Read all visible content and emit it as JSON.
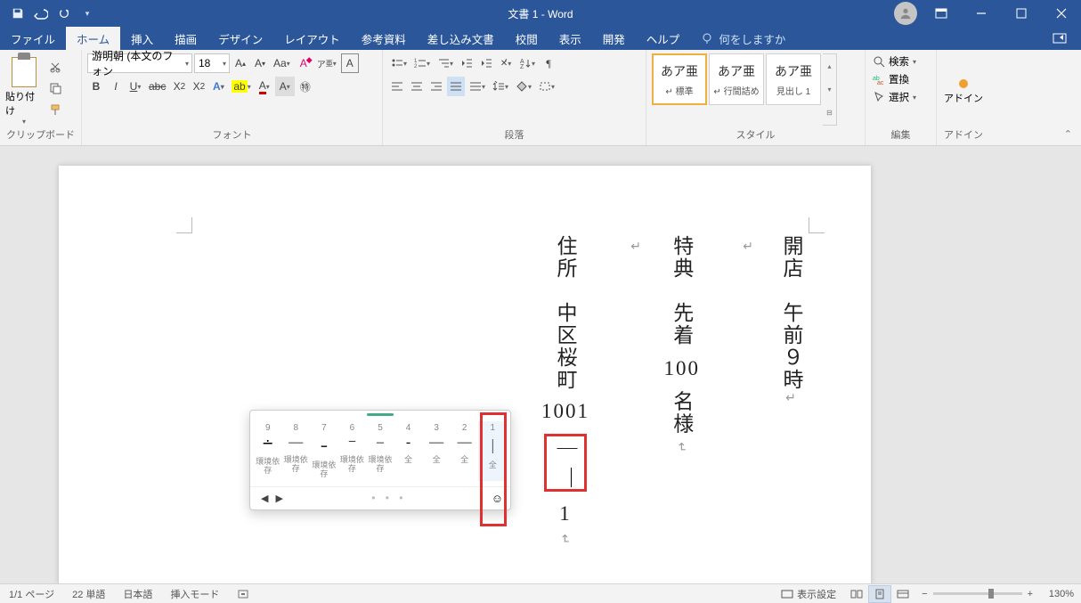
{
  "app": {
    "title": "文書 1  -  Word"
  },
  "qat": {
    "save": "save",
    "undo": "undo",
    "redo": "redo"
  },
  "tabs": {
    "file": "ファイル",
    "home": "ホーム",
    "insert": "挿入",
    "draw": "描画",
    "design": "デザイン",
    "layout": "レイアウト",
    "references": "参考資料",
    "mailings": "差し込み文書",
    "review": "校閲",
    "view": "表示",
    "developer": "開発",
    "help": "ヘルプ",
    "tellme": "何をしますか"
  },
  "ribbon": {
    "clipboard": {
      "label": "クリップボード",
      "paste": "貼り付け"
    },
    "font": {
      "label": "フォント",
      "family": "游明朝 (本文のフォン",
      "size": "18"
    },
    "paragraph": {
      "label": "段落"
    },
    "styles": {
      "label": "スタイル",
      "items": [
        {
          "preview": "あア亜",
          "name": "↵ 標準"
        },
        {
          "preview": "あア亜",
          "name": "↵ 行間詰め"
        },
        {
          "preview": "あア亜",
          "name": "見出し 1"
        }
      ]
    },
    "editing": {
      "label": "編集",
      "find": "検索",
      "replace": "置換",
      "select": "選択"
    },
    "addins": {
      "label": "アドイン",
      "btn": "アドイン"
    }
  },
  "document": {
    "col1": {
      "text": "開店　午前９時",
      "ret": "↵"
    },
    "col2": {
      "pre": "特典　先着",
      "num": "100",
      "post": "名様",
      "ret": "↵"
    },
    "col3": {
      "pre": "住所　中区桜町",
      "num1": "1001",
      "dash": "｜",
      "num2": "1",
      "ret": "↵"
    },
    "ret_above1": "↵",
    "ret_above2": "↵"
  },
  "ime": {
    "candidates": [
      {
        "idx": "1",
        "ch": "｜",
        "tag": "全"
      },
      {
        "idx": "2",
        "ch": "—",
        "tag": "全"
      },
      {
        "idx": "3",
        "ch": "―",
        "tag": "全"
      },
      {
        "idx": "4",
        "ch": "‐",
        "tag": "全"
      },
      {
        "idx": "5",
        "ch": "–",
        "tag": "環境依存"
      },
      {
        "idx": "6",
        "ch": "−",
        "tag": "環境依存"
      },
      {
        "idx": "7",
        "ch": "ｰ",
        "tag": "環境依存"
      },
      {
        "idx": "8",
        "ch": "―",
        "tag": "環境依存"
      },
      {
        "idx": "9",
        "ch": "∸",
        "tag": "環境依存"
      }
    ]
  },
  "status": {
    "page": "1/1 ページ",
    "words": "22 単語",
    "lang": "日本語",
    "mode": "挿入モード",
    "display": "表示設定",
    "zoom": "130%"
  }
}
